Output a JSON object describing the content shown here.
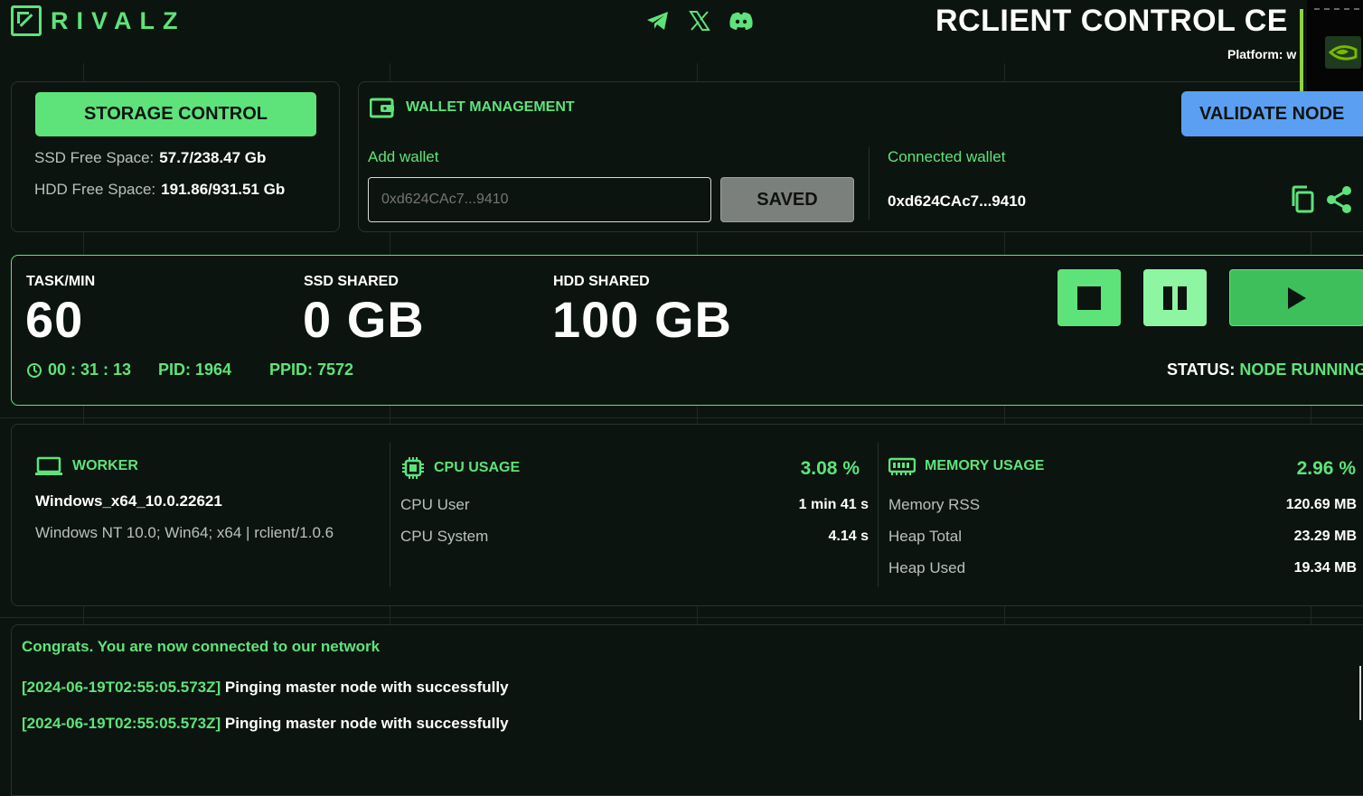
{
  "colors": {
    "accent": "#5ee37a",
    "blue_button": "#5b9ff2",
    "background": "#0c140f"
  },
  "header": {
    "logo_text": "RIVALZ",
    "social_icons": [
      "telegram-icon",
      "x-icon",
      "discord-icon"
    ],
    "title": "RCLIENT CONTROL CE",
    "platform_label": "Platform: w"
  },
  "storage": {
    "button_label": "STORAGE CONTROL",
    "ssd_label": "SSD Free Space:",
    "ssd_value": "57.7/238.47 Gb",
    "hdd_label": "HDD Free Space:",
    "hdd_value": "191.86/931.51 Gb"
  },
  "wallet": {
    "title": "WALLET MANAGEMENT",
    "add_label": "Add wallet",
    "input_placeholder": "0xd624CAc7...9410",
    "saved_label": "SAVED",
    "connected_label": "Connected wallet",
    "connected_value": "0xd624CAc7...9410",
    "validate_label": "VALIDATE NODE"
  },
  "node": {
    "task_label": "TASK/MIN",
    "task_value": "60",
    "ssd_label": "SSD SHARED",
    "ssd_value": "0 GB",
    "hdd_label": "HDD SHARED",
    "hdd_value": "100 GB",
    "uptime": "00 : 31 : 13",
    "pid": "PID: 1964",
    "ppid": "PPID: 7572",
    "status_label": "STATUS:",
    "status_value": "NODE RUNNING"
  },
  "worker": {
    "title": "WORKER",
    "os": "Windows_x64_10.0.22621",
    "agent": "Windows NT 10.0; Win64; x64 | rclient/1.0.6"
  },
  "cpu": {
    "title": "CPU USAGE",
    "percent": "3.08 %",
    "rows": [
      {
        "label": "CPU User",
        "value": "1 min 41 s"
      },
      {
        "label": "CPU System",
        "value": "4.14 s"
      }
    ]
  },
  "memory": {
    "title": "MEMORY USAGE",
    "percent": "2.96 %",
    "rows": [
      {
        "label": "Memory RSS",
        "value": "120.69 MB"
      },
      {
        "label": "Heap Total",
        "value": "23.29 MB"
      },
      {
        "label": "Heap Used",
        "value": "19.34 MB"
      }
    ]
  },
  "log": {
    "message": "Congrats. You are now connected to our network",
    "entries": [
      {
        "timestamp": "[2024-06-19T02:55:05.573Z]",
        "text": "Pinging master node with successfully"
      },
      {
        "timestamp": "[2024-06-19T02:55:05.573Z]",
        "text": "Pinging master node with successfully"
      }
    ]
  }
}
